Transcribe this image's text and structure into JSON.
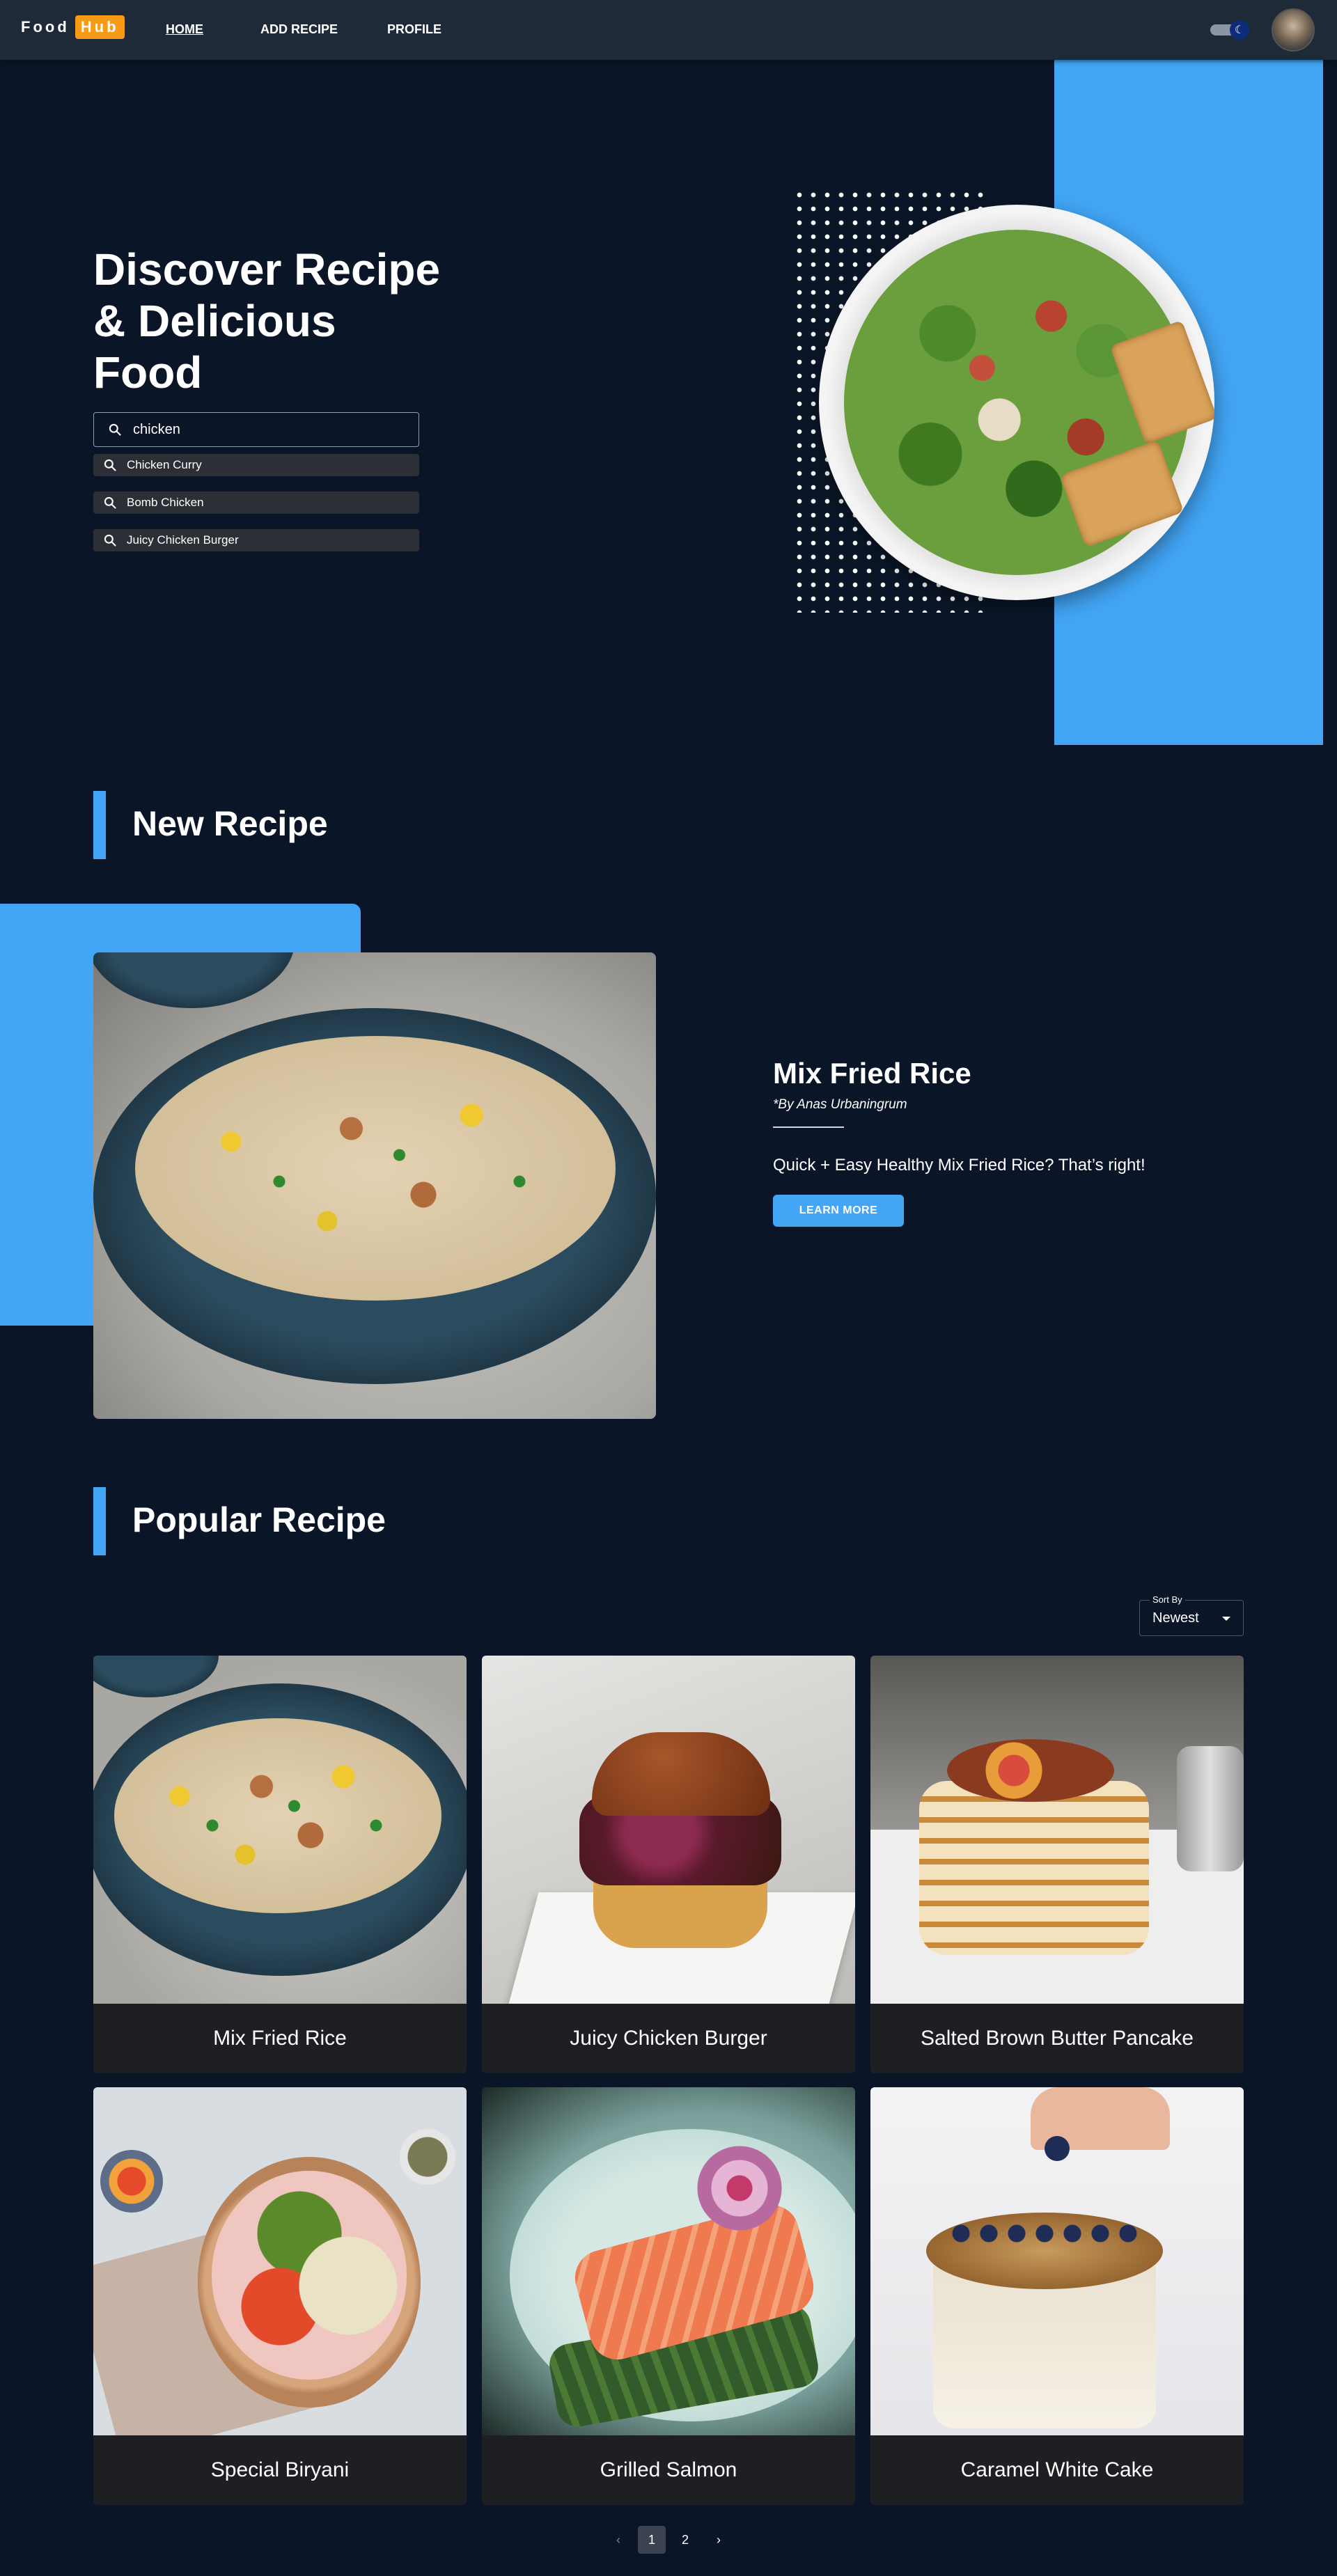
{
  "navbar": {
    "logo_part1": "Food",
    "logo_part2": "Hub",
    "links": [
      {
        "label": "HOME",
        "active": true
      },
      {
        "label": "ADD RECIPE",
        "active": false
      },
      {
        "label": "PROFILE",
        "active": false
      }
    ],
    "theme_toggle_icon": "moon-icon",
    "avatar": "user-avatar"
  },
  "hero": {
    "title_line1": "Discover Recipe",
    "title_line2": "& Delicious",
    "title_line3": "Food",
    "search_value": "chicken",
    "suggestions": [
      "Chicken Curry",
      "Bomb Chicken",
      "Juicy Chicken Burger"
    ],
    "image": "caesar-salad-plate"
  },
  "new_recipe": {
    "section_title": "New Recipe",
    "title": "Mix Fried Rice",
    "author": "*By Anas Urbaningrum",
    "description": "Quick + Easy Healthy Mix Fried Rice? That’s right!",
    "button_label": "LEARN MORE"
  },
  "popular": {
    "section_title": "Popular Recipe",
    "sort_label": "Sort By",
    "sort_value": "Newest",
    "recipes": [
      {
        "name": "Mix Fried Rice"
      },
      {
        "name": "Juicy Chicken Burger"
      },
      {
        "name": "Salted Brown Butter Pancake"
      },
      {
        "name": "Special Biryani"
      },
      {
        "name": "Grilled Salmon"
      },
      {
        "name": "Caramel White Cake"
      }
    ]
  },
  "pagination": {
    "pages": [
      "1",
      "2"
    ],
    "current": "1"
  },
  "colors": {
    "background": "#0a1628",
    "navbar": "#1f2a38",
    "accent": "#42a5f5",
    "logo_badge": "#f79a16",
    "card_footer": "#1e1f22"
  }
}
